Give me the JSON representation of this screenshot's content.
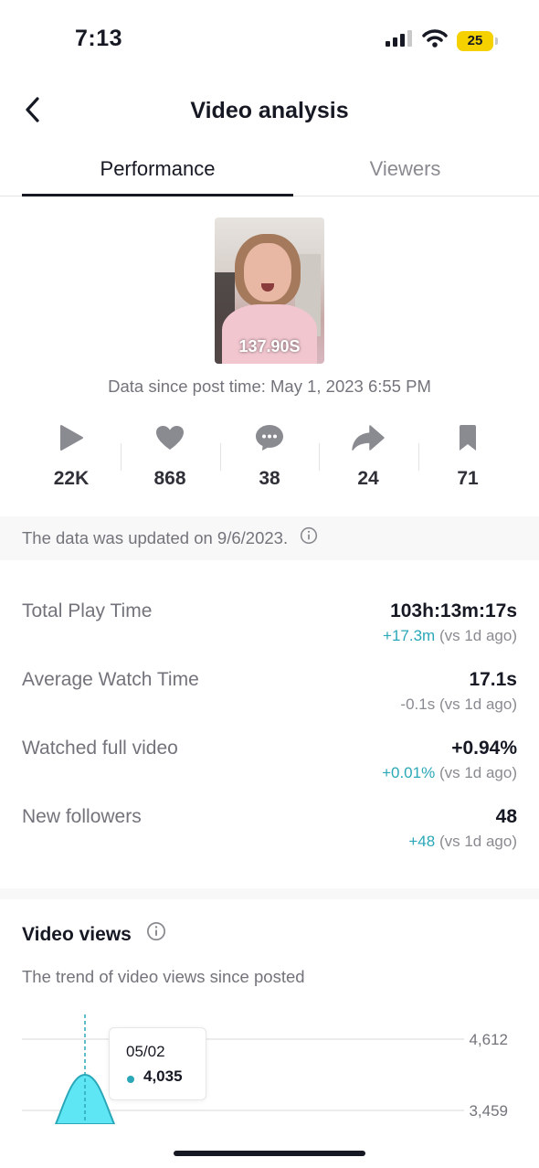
{
  "status_bar": {
    "time": "7:13",
    "battery": "25",
    "icons": [
      "signal-icon",
      "wifi-icon",
      "battery-icon"
    ]
  },
  "nav": {
    "title": "Video analysis",
    "back_icon": "chevron-left-icon"
  },
  "tabs": [
    {
      "label": "Performance",
      "active": true
    },
    {
      "label": "Viewers",
      "active": false
    }
  ],
  "video": {
    "views_overlay": "137.90S",
    "post_time": "Data since post time: May 1, 2023 6:55 PM"
  },
  "engagement": [
    {
      "icon": "play-icon",
      "value": "22K"
    },
    {
      "icon": "heart-icon",
      "value": "868"
    },
    {
      "icon": "comment-icon",
      "value": "38"
    },
    {
      "icon": "share-icon",
      "value": "24"
    },
    {
      "icon": "bookmark-icon",
      "value": "71"
    }
  ],
  "notice": {
    "text": "The data was updated on 9/6/2023."
  },
  "metrics": [
    {
      "label": "Total Play Time",
      "value": "103h:13m:17s",
      "delta": "+17.3m",
      "compare": "(vs 1d ago)"
    },
    {
      "label": "Average Watch Time",
      "value": "17.1s",
      "delta": "-0.1s",
      "compare": "(vs 1d ago)"
    },
    {
      "label": "Watched full video",
      "value": "+0.94%",
      "delta": "+0.01%",
      "compare": "(vs 1d ago)"
    },
    {
      "label": "New followers",
      "value": "48",
      "delta": "+48",
      "compare": "(vs 1d ago)"
    }
  ],
  "video_views": {
    "title": "Video views",
    "description": "The trend of video views since posted",
    "tooltip": {
      "date": "05/02",
      "value": "4,035"
    }
  },
  "colors": {
    "accent": "#2aa7b8",
    "chart_fill": "#5fe6f5",
    "text_primary": "#161823",
    "text_secondary": "#73747b",
    "battery": "#f5d100"
  },
  "chart_data": {
    "type": "area",
    "title": "",
    "xlabel": "",
    "ylabel": "",
    "y_ticks": [
      "4,612",
      "3,459"
    ],
    "x": [
      "05/02"
    ],
    "values": [
      4035
    ],
    "grid": true,
    "legend": "none"
  }
}
